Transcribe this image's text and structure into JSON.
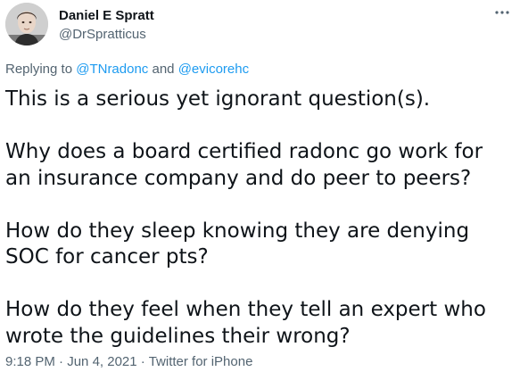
{
  "author": {
    "name": "Daniel E Spratt",
    "handle": "@DrSpratticus",
    "avatar_icon": "profile-photo"
  },
  "more_icon": "ellipsis-horizontal-icon",
  "reply_context": {
    "prefix": "Replying to",
    "mention_1": "@TNradonc",
    "conjunction": "and",
    "mention_2": "@evicorehc"
  },
  "tweet": {
    "paragraphs": [
      "This is a serious yet ignorant question(s).",
      "Why does a board certified radonc go work for an insurance company and do peer to peers?",
      "How do they sleep knowing they are denying SOC for cancer pts?",
      "How do they feel when they tell an expert who wrote the guidelines their wrong?"
    ]
  },
  "meta": {
    "time": "9:18 PM",
    "separator": "·",
    "date": "Jun 4, 2021",
    "source": "Twitter for iPhone"
  },
  "colors": {
    "text": "#0f1419",
    "secondary": "#536471",
    "link": "#1d9bf0",
    "background": "#ffffff"
  }
}
